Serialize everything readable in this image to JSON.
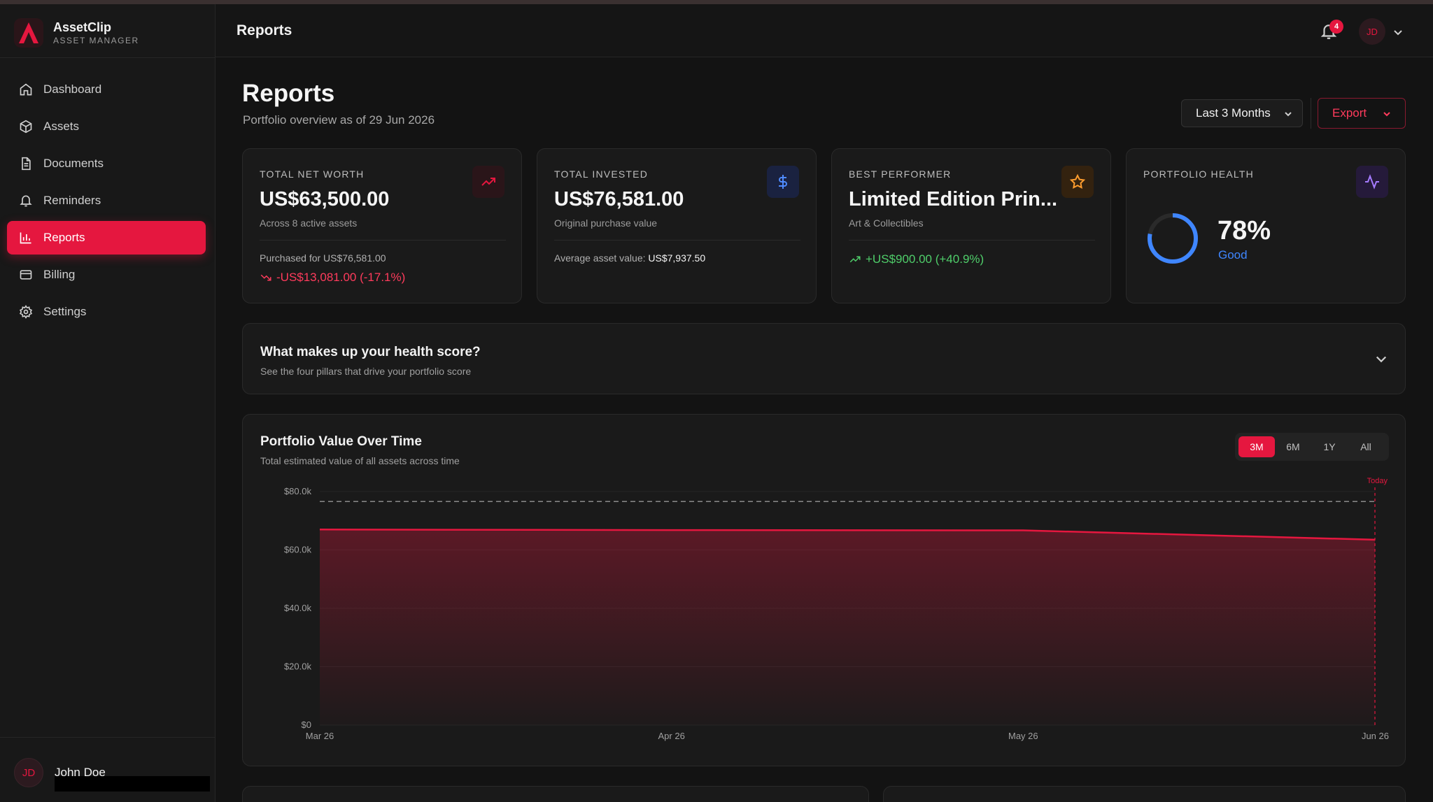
{
  "app": {
    "name": "AssetClip",
    "subtitle": "ASSET MANAGER"
  },
  "sidebar": {
    "items": [
      {
        "label": "Dashboard",
        "icon": "home-icon"
      },
      {
        "label": "Assets",
        "icon": "box-icon"
      },
      {
        "label": "Documents",
        "icon": "document-icon"
      },
      {
        "label": "Reminders",
        "icon": "bell-icon"
      },
      {
        "label": "Reports",
        "icon": "bar-chart-icon",
        "active": true
      },
      {
        "label": "Billing",
        "icon": "credit-card-icon"
      },
      {
        "label": "Settings",
        "icon": "gear-icon"
      }
    ],
    "user": {
      "initials": "JD",
      "name": "John Doe"
    }
  },
  "header": {
    "title": "Reports",
    "notifications": "4",
    "avatar_initials": "JD"
  },
  "page": {
    "title": "Reports",
    "subtitle": "Portfolio overview as of 29 Jun 2026",
    "range": "Last 3 Months",
    "export_label": "Export"
  },
  "cards": {
    "net_worth": {
      "label": "TOTAL NET WORTH",
      "value": "US$63,500.00",
      "note": "Across 8 active assets",
      "purchased": "Purchased for US$76,581.00",
      "change": "-US$13,081.00 (-17.1%)"
    },
    "invested": {
      "label": "TOTAL INVESTED",
      "value": "US$76,581.00",
      "note": "Original purchase value",
      "avg_label": "Average asset value:",
      "avg_value": "US$7,937.50"
    },
    "best": {
      "label": "BEST PERFORMER",
      "value": "Limited Edition Prin...",
      "note": "Art & Collectibles",
      "change": "+US$900.00 (+40.9%)"
    },
    "health": {
      "label": "PORTFOLIO HEALTH",
      "percent": "78%",
      "value": 0.78,
      "status": "Good"
    }
  },
  "accordion": {
    "title": "What makes up your health score?",
    "subtitle": "See the four pillars that drive your portfolio score"
  },
  "chart_section": {
    "title": "Portfolio Value Over Time",
    "subtitle": "Total estimated value of all assets across time",
    "ranges": [
      "3M",
      "6M",
      "1Y",
      "All"
    ],
    "active_range": "3M"
  },
  "colors": {
    "accent": "#e5173f",
    "positive": "#4fce6a",
    "health": "#3f86ff",
    "background": "#131313"
  },
  "chart_data": {
    "type": "area",
    "x": [
      "Mar 26",
      "Apr 26",
      "May 26",
      "Jun 26"
    ],
    "y": [
      67000,
      66800,
      66700,
      63500
    ],
    "x_ticks": [
      "Mar 26",
      "Apr 26",
      "May 26",
      "Jun 26"
    ],
    "y_ticks": [
      "$0",
      "$20.0k",
      "$40.0k",
      "$60.0k",
      "$80.0k"
    ],
    "ylim": [
      0,
      80000
    ],
    "reference_line": {
      "label": "",
      "value": 76581
    },
    "marker_label": "Today",
    "grid": true
  }
}
